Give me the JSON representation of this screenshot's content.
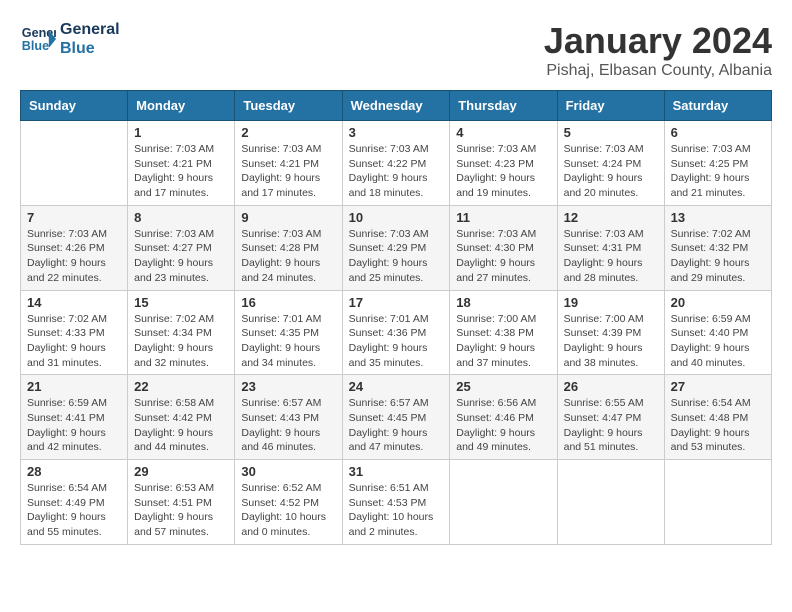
{
  "logo": {
    "line1": "General",
    "line2": "Blue"
  },
  "title": "January 2024",
  "location": "Pishaj, Elbasan County, Albania",
  "days_header": [
    "Sunday",
    "Monday",
    "Tuesday",
    "Wednesday",
    "Thursday",
    "Friday",
    "Saturday"
  ],
  "weeks": [
    [
      {
        "day": "",
        "info": ""
      },
      {
        "day": "1",
        "info": "Sunrise: 7:03 AM\nSunset: 4:21 PM\nDaylight: 9 hours\nand 17 minutes."
      },
      {
        "day": "2",
        "info": "Sunrise: 7:03 AM\nSunset: 4:21 PM\nDaylight: 9 hours\nand 17 minutes."
      },
      {
        "day": "3",
        "info": "Sunrise: 7:03 AM\nSunset: 4:22 PM\nDaylight: 9 hours\nand 18 minutes."
      },
      {
        "day": "4",
        "info": "Sunrise: 7:03 AM\nSunset: 4:23 PM\nDaylight: 9 hours\nand 19 minutes."
      },
      {
        "day": "5",
        "info": "Sunrise: 7:03 AM\nSunset: 4:24 PM\nDaylight: 9 hours\nand 20 minutes."
      },
      {
        "day": "6",
        "info": "Sunrise: 7:03 AM\nSunset: 4:25 PM\nDaylight: 9 hours\nand 21 minutes."
      }
    ],
    [
      {
        "day": "7",
        "info": ""
      },
      {
        "day": "8",
        "info": "Sunrise: 7:03 AM\nSunset: 4:27 PM\nDaylight: 9 hours\nand 23 minutes."
      },
      {
        "day": "9",
        "info": "Sunrise: 7:03 AM\nSunset: 4:28 PM\nDaylight: 9 hours\nand 24 minutes."
      },
      {
        "day": "10",
        "info": "Sunrise: 7:03 AM\nSunset: 4:29 PM\nDaylight: 9 hours\nand 25 minutes."
      },
      {
        "day": "11",
        "info": "Sunrise: 7:03 AM\nSunset: 4:30 PM\nDaylight: 9 hours\nand 27 minutes."
      },
      {
        "day": "12",
        "info": "Sunrise: 7:03 AM\nSunset: 4:31 PM\nDaylight: 9 hours\nand 28 minutes."
      },
      {
        "day": "13",
        "info": "Sunrise: 7:02 AM\nSunset: 4:32 PM\nDaylight: 9 hours\nand 29 minutes."
      }
    ],
    [
      {
        "day": "14",
        "info": ""
      },
      {
        "day": "15",
        "info": "Sunrise: 7:02 AM\nSunset: 4:34 PM\nDaylight: 9 hours\nand 32 minutes."
      },
      {
        "day": "16",
        "info": "Sunrise: 7:01 AM\nSunset: 4:35 PM\nDaylight: 9 hours\nand 34 minutes."
      },
      {
        "day": "17",
        "info": "Sunrise: 7:01 AM\nSunset: 4:36 PM\nDaylight: 9 hours\nand 35 minutes."
      },
      {
        "day": "18",
        "info": "Sunrise: 7:00 AM\nSunset: 4:38 PM\nDaylight: 9 hours\nand 37 minutes."
      },
      {
        "day": "19",
        "info": "Sunrise: 7:00 AM\nSunset: 4:39 PM\nDaylight: 9 hours\nand 38 minutes."
      },
      {
        "day": "20",
        "info": "Sunrise: 6:59 AM\nSunset: 4:40 PM\nDaylight: 9 hours\nand 40 minutes."
      }
    ],
    [
      {
        "day": "21",
        "info": "Sunrise: 6:59 AM\nSunset: 4:41 PM\nDaylight: 9 hours\nand 42 minutes."
      },
      {
        "day": "22",
        "info": "Sunrise: 6:58 AM\nSunset: 4:42 PM\nDaylight: 9 hours\nand 44 minutes."
      },
      {
        "day": "23",
        "info": "Sunrise: 6:57 AM\nSunset: 4:43 PM\nDaylight: 9 hours\nand 46 minutes."
      },
      {
        "day": "24",
        "info": "Sunrise: 6:57 AM\nSunset: 4:45 PM\nDaylight: 9 hours\nand 47 minutes."
      },
      {
        "day": "25",
        "info": "Sunrise: 6:56 AM\nSunset: 4:46 PM\nDaylight: 9 hours\nand 49 minutes."
      },
      {
        "day": "26",
        "info": "Sunrise: 6:55 AM\nSunset: 4:47 PM\nDaylight: 9 hours\nand 51 minutes."
      },
      {
        "day": "27",
        "info": "Sunrise: 6:54 AM\nSunset: 4:48 PM\nDaylight: 9 hours\nand 53 minutes."
      }
    ],
    [
      {
        "day": "28",
        "info": "Sunrise: 6:54 AM\nSunset: 4:49 PM\nDaylight: 9 hours\nand 55 minutes."
      },
      {
        "day": "29",
        "info": "Sunrise: 6:53 AM\nSunset: 4:51 PM\nDaylight: 9 hours\nand 57 minutes."
      },
      {
        "day": "30",
        "info": "Sunrise: 6:52 AM\nSunset: 4:52 PM\nDaylight: 10 hours\nand 0 minutes."
      },
      {
        "day": "31",
        "info": "Sunrise: 6:51 AM\nSunset: 4:53 PM\nDaylight: 10 hours\nand 2 minutes."
      },
      {
        "day": "",
        "info": ""
      },
      {
        "day": "",
        "info": ""
      },
      {
        "day": "",
        "info": ""
      }
    ]
  ],
  "week1_sun_info": "Sunrise: 7:03 AM\nSunset: 4:26 PM\nDaylight: 9 hours\nand 22 minutes."
}
